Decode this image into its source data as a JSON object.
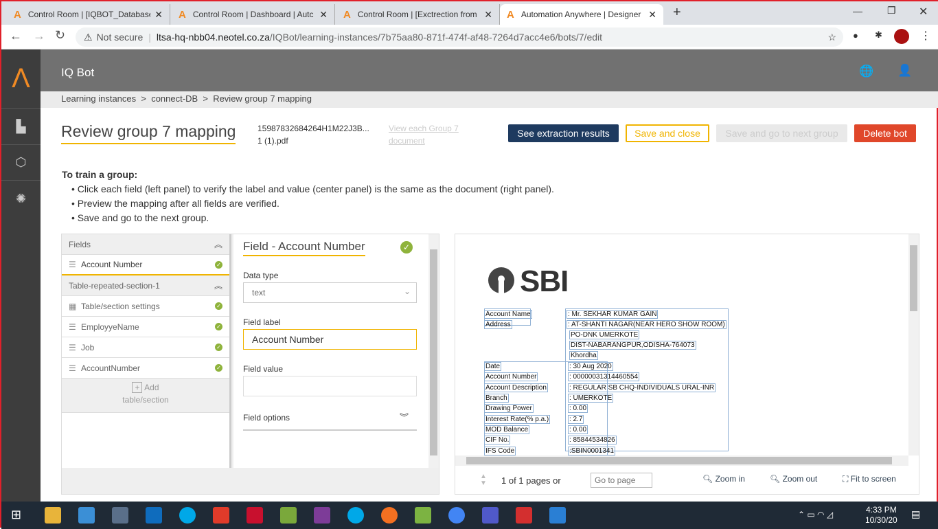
{
  "browser": {
    "tabs": [
      {
        "title": "Control Room | [IQBOT_Database"
      },
      {
        "title": "Control Room | Dashboard | Autc"
      },
      {
        "title": "Control Room | [Exctrection from"
      },
      {
        "title": "Automation Anywhere | Designer"
      }
    ],
    "security": "Not secure",
    "url_host": "ltsa-hq-nbb04.neotel.co.za",
    "url_path": "/IQBot/learning-instances/7b75aa80-871f-474f-af48-7264d7acc4e6/bots/7/edit"
  },
  "app": {
    "title": "IQ Bot"
  },
  "breadcrumb": [
    "Learning instances",
    ">",
    "connect-DB",
    ">",
    "Review group 7 mapping"
  ],
  "page": {
    "title": "Review group 7 mapping",
    "file_line1": "15987832684264H1M22J3B...",
    "file_line2": "1 (1).pdf",
    "view_link_1": "View each Group 7",
    "view_link_2": "document",
    "see_results": "See extraction results",
    "save_close": "Save and close",
    "save_next": "Save and go to next group",
    "delete": "Delete bot"
  },
  "instructions": {
    "heading": "To train a group:",
    "items": [
      "Click each field (left panel) to verify the label and value (center panel) is the same as the document (right panel).",
      "Preview the mapping after all fields are verified.",
      "Save and go to the next group."
    ]
  },
  "fields_panel": {
    "header": "Fields",
    "fields": [
      {
        "label": "Account Number"
      }
    ],
    "section": "Table-repeated-section-1",
    "section_items": [
      {
        "label": "Table/section settings"
      },
      {
        "label": "EmployyeName"
      },
      {
        "label": "Job"
      },
      {
        "label": "AccountNumber"
      }
    ],
    "add_1": "Add",
    "add_2": "table/section"
  },
  "field_editor": {
    "title": "Field - Account Number",
    "data_type_label": "Data type",
    "data_type_value": "text",
    "field_label_label": "Field label",
    "field_label_value": "Account Number",
    "field_value_label": "Field value",
    "field_value_value": "",
    "options_label": "Field options"
  },
  "document": {
    "logo": "SBI",
    "labels": [
      "Account Name",
      "Address",
      "Date",
      "Account Number",
      "Account Description",
      "Branch",
      "Drawing Power",
      "Interest Rate(% p.a.)",
      "MOD Balance",
      "CIF No.",
      "IFS Code"
    ],
    "values": [
      ": Mr. SEKHAR KUMAR  GAIN",
      ":  AT-SHANTI NAGAR(NEAR HERO SHOW ROOM)",
      "PO-DNK UMERKOTE",
      "DIST-NABARANGPUR,ODISHA-764073",
      "Khordha",
      ": 30 Aug 2020",
      ": 00000031314460554",
      ": REGULAR SB CHQ-INDIVIDUALS URAL-INR",
      ": UMERKOTE",
      ": 0.00",
      ": 2.7",
      ": 0.00",
      ": 85844534826",
      ":SBIN0001341"
    ]
  },
  "viewer": {
    "pages": "1 of 1 pages or",
    "goto_placeholder": "Go to page",
    "zoom_in": "Zoom in",
    "zoom_out": "Zoom out",
    "fit": "Fit to screen"
  },
  "taskbar": {
    "time": "4:33 PM",
    "date": "10/30/20"
  }
}
